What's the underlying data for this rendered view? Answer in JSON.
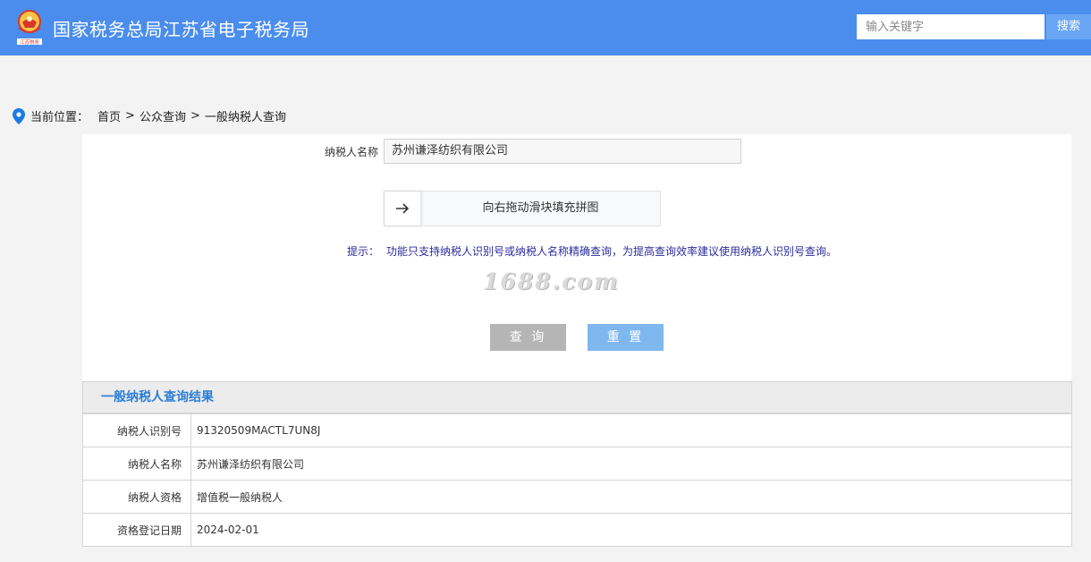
{
  "header": {
    "logo_caption": "江苏税务",
    "title": "国家税务总局江苏省电子税务局",
    "search": {
      "placeholder": "输入关键字",
      "button": "搜索"
    }
  },
  "breadcrumb": {
    "label": "当前位置：",
    "items": [
      "首页",
      "公众查询",
      "一般纳税人查询"
    ],
    "separator": ">"
  },
  "form": {
    "name_label": "纳税人名称",
    "name_value": "苏州谦泽纺织有限公司",
    "slider_text": "向右拖动滑块填充拼图",
    "tip_label": "提示：",
    "tip_text": "功能只支持纳税人识别号或纳税人名称精确查询，为提高查询效率建议使用纳税人识别号查询。",
    "query_button": "查 询",
    "reset_button": "重 置"
  },
  "watermark": "1688.com",
  "result": {
    "title": "一般纳税人查询结果",
    "rows": [
      {
        "label": "纳税人识别号",
        "value": "91320509MACTL7UN8J"
      },
      {
        "label": "纳税人名称",
        "value": "苏州谦泽纺织有限公司"
      },
      {
        "label": "纳税人资格",
        "value": "增值税一般纳税人"
      },
      {
        "label": "资格登记日期",
        "value": "2024-02-01"
      }
    ]
  },
  "colors": {
    "header_bg": "#4a8ded",
    "result_title": "#2c7ed6",
    "tip": "#2b2b9e"
  }
}
